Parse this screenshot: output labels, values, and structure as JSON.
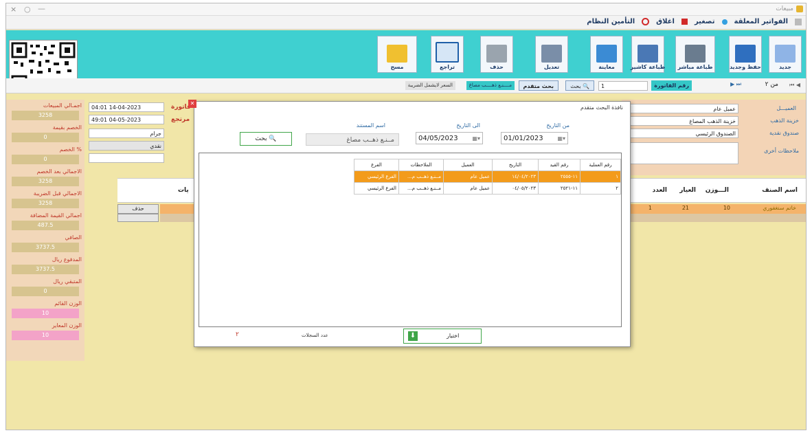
{
  "window": {
    "title": "مبيعات",
    "controls": [
      "×",
      "○",
      "—"
    ]
  },
  "menu": {
    "items": [
      "الفواتير المعلقة",
      "تصغير",
      "اغلاق",
      "التأمين النظام"
    ]
  },
  "toolbar": {
    "buttons": [
      {
        "label": "جديد",
        "icon": "new-document-icon"
      },
      {
        "label": "حفظ وجديد",
        "icon": "save-icon"
      },
      {
        "label": "طباعة مباشر",
        "icon": "printer-icon"
      },
      {
        "label": "طباعة كاشير",
        "icon": "cashier-print-icon"
      },
      {
        "label": "معاينة",
        "icon": "preview-icon"
      },
      {
        "label": "تعديل",
        "icon": "edit-icon"
      },
      {
        "label": "حذف",
        "icon": "delete-icon"
      },
      {
        "label": "تراجع",
        "icon": "undo-icon"
      },
      {
        "label": "مسح",
        "icon": "clear-icon"
      }
    ]
  },
  "navbar": {
    "page_of": "من ٢",
    "invoice_no_label": "رقم الفاتورة",
    "invoice_no_value": "1",
    "search_btn": "بحث",
    "advanced_search_btn": "بحث متقدم",
    "tag1": "مــــنـع ذهــــب مصاغ",
    "tag2": "السعر لايشمل الضريبة"
  },
  "left_panel": {
    "rows": [
      {
        "label": "اجمـالي المبيعات",
        "value": "3258",
        "kind": "sum"
      },
      {
        "label": "الخصم بقيمة",
        "value": "0",
        "kind": "sum"
      },
      {
        "label": "الخصم %",
        "value": "0",
        "kind": "sum"
      },
      {
        "label": "الاجمالي بعد الخصم",
        "value": "3258",
        "kind": "sum"
      },
      {
        "label": "الاجمالي قبل الضريبة",
        "value": "3258",
        "kind": "sum"
      },
      {
        "label": "اجمالي القيمة المضافة",
        "value": "487.5",
        "kind": "sum"
      },
      {
        "label": "الصافي",
        "value": "3737.5",
        "kind": "sum"
      },
      {
        "label": "المدفوع ريال",
        "value": "3737.5",
        "kind": "sum"
      },
      {
        "label": "المتبقي ريال",
        "value": "0",
        "kind": "sum"
      },
      {
        "label": "الوزن القائم",
        "value": "10",
        "kind": "pink"
      },
      {
        "label": "الوزن المعاير",
        "value": "10",
        "kind": "pink"
      }
    ]
  },
  "header_fields": {
    "date1": "04:01 14-04-2023",
    "date2": "49:01 04-05-2023",
    "unit": "جرام",
    "payment": "نقدي",
    "lbl_invoice": "فاتورة",
    "lbl_due": "مرتجع"
  },
  "right_panel": {
    "customer_label": "العميـــل",
    "customer_value": "عميل عام",
    "store_label": "خزينة الذهب",
    "store_value": "خزينة الذهب المصاغ",
    "cashbox_label": "صندوق نقدية",
    "cashbox_value": "الصندوق الرئيسي",
    "notes_label": "ملاحظات أخرى"
  },
  "grid": {
    "columns": [
      "اسم الصنف",
      "الـــوزن",
      "العيار",
      "العدد",
      "يات"
    ],
    "row1": {
      "name": "خاتم سنغفوري",
      "weight": "10",
      "karat": "21",
      "count": "1"
    },
    "delete_btn": "حذف"
  },
  "dialog": {
    "title": "نافذة البحث متقدم",
    "from_date_label": "من التاريخ",
    "from_date": "01/01/2023",
    "to_date_label": "الى التاريخ",
    "to_date": "04/05/2023",
    "doc_name_label": "اسم المستند",
    "doc_name": "مــنـع ذهــب مصاغ",
    "search_btn": "بحث",
    "table": {
      "headers": [
        "رقم العملية",
        "رقم القيد",
        "التاريخ",
        "العميل",
        "الملاحظات",
        "الفرع"
      ],
      "rows": [
        [
          "١",
          "١١-٢٥٥٥",
          "١٤/٠٤/٢٠٢٣",
          "عميل عام",
          "مــنـع ذهــب م...",
          "الفرع الرئيسي"
        ],
        [
          "٢",
          "١١-٢٥٢١",
          "٠٤/٠٥/٢٠٢٣",
          "عميل عام",
          "مــنـع ذهــب م...",
          "الفرع الرئيسي"
        ]
      ]
    },
    "count_label": "عدد السجلات",
    "count_value": "٢",
    "choose_btn": "اختيار",
    "close_icon": "close-icon"
  }
}
